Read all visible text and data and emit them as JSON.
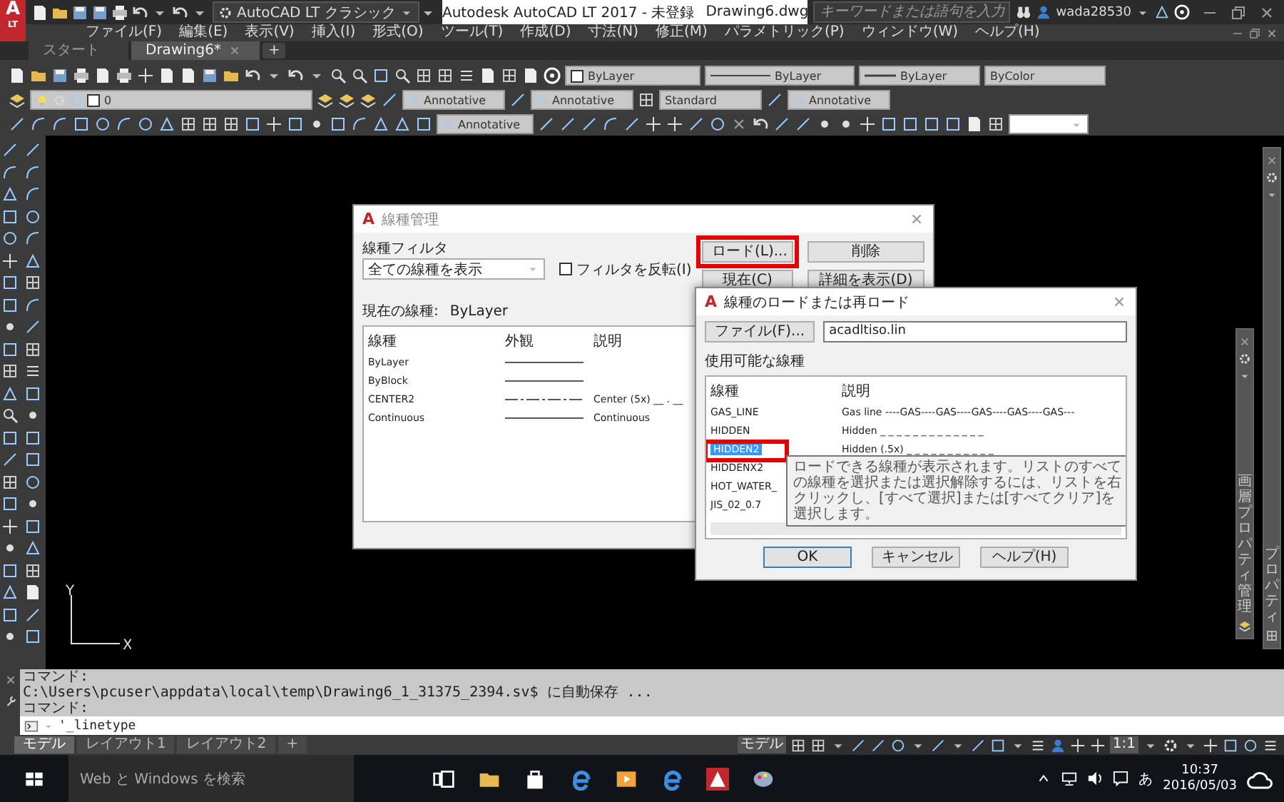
{
  "app": {
    "logo": "A",
    "logo_sub": "LT",
    "workspace": "AutoCAD LT クラシック",
    "title": "Autodesk AutoCAD LT 2017 - 未登録",
    "file": "Drawing6.dwg",
    "search": {
      "placeholder": "キーワードまたは語句を入力"
    },
    "user": "wada28530"
  },
  "menu": [
    "ファイル(F)",
    "編集(E)",
    "表示(V)",
    "挿入(I)",
    "形式(O)",
    "ツール(T)",
    "作成(D)",
    "寸法(N)",
    "修正(M)",
    "パラメトリック(P)",
    "ウィンドウ(W)",
    "ヘルプ(H)"
  ],
  "tabs": [
    {
      "label": "スタート",
      "selected": false
    },
    {
      "label": "Drawing6*",
      "selected": true
    }
  ],
  "new_tab": "+",
  "toolbars": {
    "properties": [
      {
        "kind": "color",
        "value": "ByLayer"
      },
      {
        "kind": "linetype",
        "value": "ByLayer"
      },
      {
        "kind": "lineweight",
        "value": "ByLayer"
      },
      {
        "kind": "plot",
        "value": "ByColor"
      }
    ],
    "layer": "0",
    "styles": [
      {
        "kind": "annotative",
        "value": "Annotative"
      },
      {
        "kind": "annotative",
        "value": "Annotative"
      },
      {
        "kind": "table",
        "value": "Standard"
      },
      {
        "kind": "annotative",
        "value": "Annotative"
      }
    ],
    "dim_style": "Annotative"
  },
  "ucs": {
    "x": "X",
    "y": "Y"
  },
  "linetype_manager": {
    "logo": "A",
    "title": "線種管理",
    "filter_label": "線種フィルタ",
    "filter": "全ての線種を表示",
    "invert": {
      "label": "フィルタを反転(I)",
      "checked": false
    },
    "buttons": [
      {
        "label": "ロード(L)...",
        "highlighted": true
      },
      {
        "label": "削除",
        "highlighted": false
      },
      {
        "label": "現在(C)",
        "highlighted": false
      },
      {
        "label": "詳細を表示(D)",
        "highlighted": false
      }
    ],
    "current_label": "現在の線種:",
    "current": "ByLayer",
    "columns": [
      "線種",
      "外観",
      "説明"
    ],
    "rows": [
      {
        "name": "ByLayer",
        "kind": "solid"
      },
      {
        "name": "ByBlock",
        "kind": "solid"
      },
      {
        "name": "CENTER2",
        "kind": "center",
        "description": "Center (5x) __ . __"
      },
      {
        "name": "Continuous",
        "kind": "solid",
        "description": "Continuous"
      }
    ]
  },
  "load_dialog": {
    "logo": "A",
    "title": "線種のロードまたは再ロード",
    "file_button": "ファイル(F)...",
    "file": "acadltiso.lin",
    "list_label": "使用可能な線種",
    "columns": [
      "線種",
      "説明"
    ],
    "rows": [
      {
        "name": "GAS_LINE",
        "description": "Gas line ----GAS----GAS----GAS----GAS----GAS---",
        "selected": false,
        "highlighted": false
      },
      {
        "name": "HIDDEN",
        "description": "Hidden _ _ _ _ _ _ _ _ _ _ _ _ _",
        "selected": false,
        "highlighted": false
      },
      {
        "name": "HIDDEN2",
        "description": "Hidden (.5x) _ _ _ _ _ _ _ _ _ _ _",
        "selected": true,
        "highlighted": true
      },
      {
        "name": "HIDDENX2",
        "selected": false,
        "highlighted": false
      },
      {
        "name": "HOT_WATER_",
        "selected": false,
        "highlighted": false
      },
      {
        "name": "JIS_02_0.7",
        "selected": false,
        "highlighted": false
      }
    ],
    "tooltip": "ロードできる線種が表示されます。リストのすべての線種を選択または選択解除するには、リストを右クリックし、[すべて選択]または[すべてクリア]を選択します。",
    "buttons": [
      {
        "label": "OK",
        "default": true
      },
      {
        "label": "キャンセル",
        "default": false
      },
      {
        "label": "ヘルプ(H)",
        "default": false
      }
    ]
  },
  "palettes": [
    {
      "title": "プロパティ"
    },
    {
      "title": "画層プロパティ管理"
    }
  ],
  "command": {
    "history": [
      "コマンド:",
      "C:\\Users\\pcuser\\appdata\\local\\temp\\Drawing6_1_31375_2394.sv$ に自動保存 ...",
      "コマンド:"
    ],
    "input": "'_linetype"
  },
  "layout_tabs": [
    {
      "label": "モデル",
      "selected": true
    },
    {
      "label": "レイアウト1",
      "selected": false
    },
    {
      "label": "レイアウト2",
      "selected": false
    }
  ],
  "new_layout": "+",
  "status": {
    "space": "モデル",
    "scale": "1:1"
  },
  "taskbar": {
    "search": {
      "placeholder": "Web と Windows を検索"
    },
    "ime": "あ",
    "time": "10:37",
    "date": "2016/05/03"
  }
}
